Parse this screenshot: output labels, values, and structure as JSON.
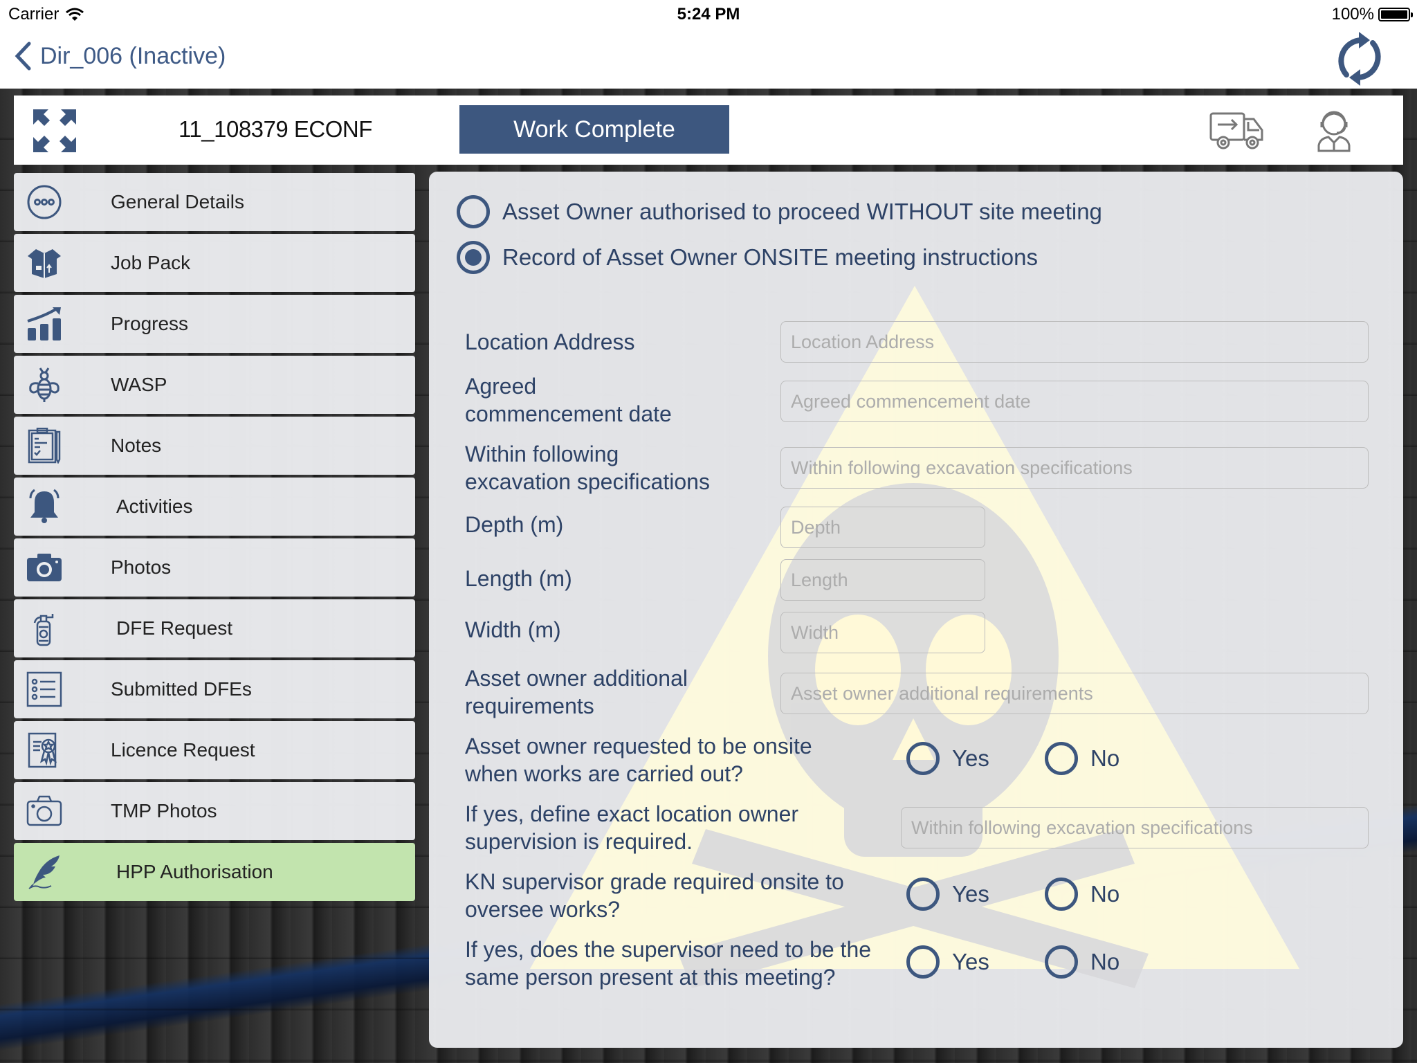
{
  "status_bar": {
    "carrier": "Carrier",
    "time": "5:24 PM",
    "battery": "100%"
  },
  "nav": {
    "back_label": "Dir_006 (Inactive)",
    "refresh_icon": "refresh-icon"
  },
  "header": {
    "job_ref": "11_108379 ECONF",
    "work_complete_label": "Work Complete",
    "icons": [
      "expand-icon",
      "truck-icon",
      "support-agent-icon"
    ]
  },
  "sidebar": {
    "items": [
      {
        "label": "General Details",
        "icon": "more-circle-icon",
        "active": false
      },
      {
        "label": "Job Pack",
        "icon": "box-icon",
        "active": false
      },
      {
        "label": "Progress",
        "icon": "chart-growth-icon",
        "active": false
      },
      {
        "label": "WASP",
        "icon": "bee-icon",
        "active": false
      },
      {
        "label": "Notes",
        "icon": "clipboard-icon",
        "active": false
      },
      {
        "label": "Activities",
        "icon": "bell-icon",
        "active": false
      },
      {
        "label": "Photos",
        "icon": "camera-icon",
        "active": false
      },
      {
        "label": "DFE Request",
        "icon": "extinguisher-icon",
        "active": false
      },
      {
        "label": "Submitted DFEs",
        "icon": "list-icon",
        "active": false
      },
      {
        "label": "Licence Request",
        "icon": "certificate-icon",
        "active": false
      },
      {
        "label": "TMP Photos",
        "icon": "camera-outline-icon",
        "active": false
      },
      {
        "label": "HPP Authorisation",
        "icon": "quill-icon",
        "active": true
      }
    ]
  },
  "form": {
    "authorisation_options": [
      {
        "label": "Asset Owner authorised to proceed WITHOUT site meeting",
        "selected": false
      },
      {
        "label": "Record of Asset Owner ONSITE meeting instructions",
        "selected": true
      }
    ],
    "fields": {
      "location_address": {
        "label": "Location Address",
        "placeholder": "Location Address",
        "value": ""
      },
      "commencement_date": {
        "label_line1": "Agreed",
        "label_line2": "commencement date",
        "placeholder": "Agreed commencement date",
        "value": ""
      },
      "excavation_specs": {
        "label_line1": "Within following",
        "label_line2": "excavation specifications",
        "placeholder": "Within following excavation specifications",
        "value": ""
      },
      "depth": {
        "label": "Depth (m)",
        "placeholder": "Depth",
        "value": ""
      },
      "length": {
        "label": "Length (m)",
        "placeholder": "Length",
        "value": ""
      },
      "width": {
        "label": "Width (m)",
        "placeholder": "Width",
        "value": ""
      },
      "additional_requirements": {
        "label_line1": "Asset owner additional",
        "label_line2": "requirements",
        "placeholder": "Asset owner additional requirements",
        "value": ""
      },
      "supervision_location": {
        "label_line1": "If yes, define exact location owner",
        "label_line2": "supervision is required.",
        "placeholder": "Within following excavation specifications",
        "value": ""
      }
    },
    "questions": {
      "owner_onsite": {
        "label_line1": "Asset owner requested to be onsite",
        "label_line2": "when works are carried out?",
        "selected": null
      },
      "kn_supervisor": {
        "label_line1": "KN supervisor grade required onsite to",
        "label_line2": "oversee works?",
        "selected": null
      },
      "same_person": {
        "label_line1": "If yes, does the supervisor need to be the",
        "label_line2": "same person present at this meeting?",
        "selected": null
      }
    },
    "yes_label": "Yes",
    "no_label": "No"
  },
  "colors": {
    "accent": "#3d577f",
    "active_item": "#c2e4ae",
    "watermark_yellow": "#fffbdc"
  }
}
